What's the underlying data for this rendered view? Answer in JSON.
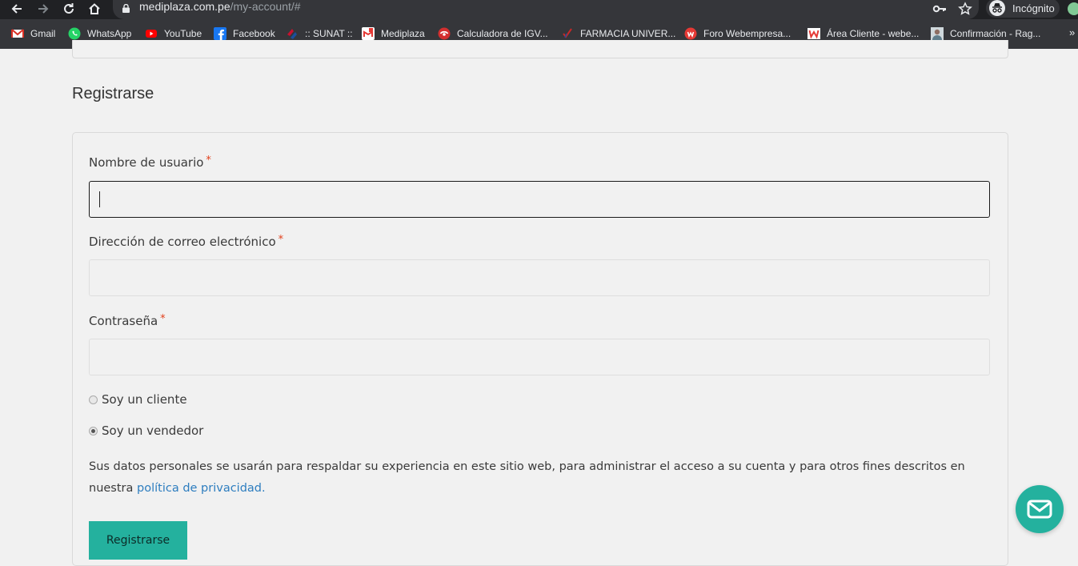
{
  "browser": {
    "url_domain": "mediplaza.com.pe",
    "url_path": "/my-account/#",
    "profile_label": "Incógnito",
    "bookmarks": [
      {
        "label": "Gmail",
        "icon": "gmail-icon",
        "color": "#d93025"
      },
      {
        "label": "WhatsApp",
        "icon": "whatsapp-icon",
        "color": "#25d366"
      },
      {
        "label": "YouTube",
        "icon": "youtube-icon",
        "color": "#ff0000"
      },
      {
        "label": "Facebook",
        "icon": "facebook-icon",
        "color": "#1877f2"
      },
      {
        "label": ":: SUNAT ::",
        "icon": "sunat-icon",
        "color": "#c8102e"
      },
      {
        "label": "Mediplaza",
        "icon": "mediplaza-icon",
        "color": "#e53935"
      },
      {
        "label": "Calculadora de IGV...",
        "icon": "calculator-icon",
        "color": "#d32f2f"
      },
      {
        "label": "FARMACIA UNIVER...",
        "icon": "pharmacy-icon",
        "color": "#c62828"
      },
      {
        "label": "Foro Webempresa...",
        "icon": "webempresa-icon",
        "color": "#e53935"
      },
      {
        "label": "Área Cliente - webe...",
        "icon": "webempresa-client-icon",
        "color": "#e53935"
      },
      {
        "label": "Confirmación - Rag...",
        "icon": "user-photo-icon",
        "color": "#9e9e9e"
      }
    ],
    "more_label": "»"
  },
  "page": {
    "heading": "Registrarse",
    "username_label": "Nombre de usuario",
    "email_label": "Dirección de correo electrónico",
    "password_label": "Contraseña",
    "required_mark": "*",
    "radio_client": "Soy un cliente",
    "radio_vendor": "Soy un vendedor",
    "privacy_text": "Sus datos personales se usarán para respaldar su experiencia en este sitio web, para administrar el acceso a su cuenta y para otros fines descritos en nuestra ",
    "privacy_link": "política de privacidad",
    "privacy_end": ".",
    "submit_label": "Registrarse",
    "accent_color": "#24b19e",
    "link_color": "#2d7dbf"
  }
}
